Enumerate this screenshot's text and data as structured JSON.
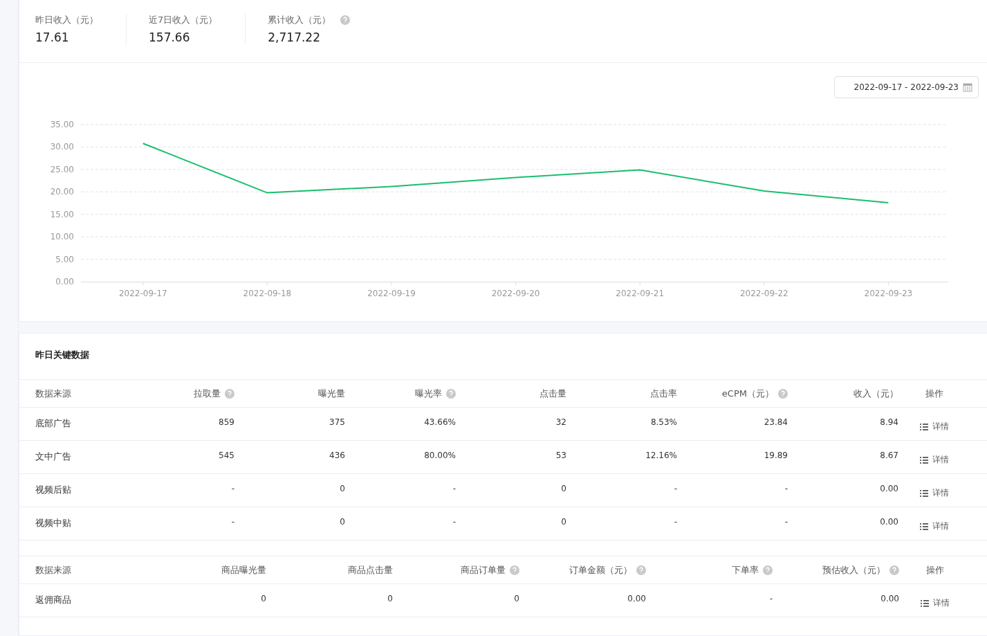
{
  "stats": [
    {
      "label": "昨日收入（元）",
      "value": "17.61",
      "help": false
    },
    {
      "label": "近7日收入（元）",
      "value": "157.66",
      "help": false
    },
    {
      "label": "累计收入（元）",
      "value": "2,717.22",
      "help": true
    }
  ],
  "date_range": "2022-09-17 - 2022-09-23",
  "chart_data": {
    "type": "line",
    "categories": [
      "2022-09-17",
      "2022-09-18",
      "2022-09-19",
      "2022-09-20",
      "2022-09-21",
      "2022-09-22",
      "2022-09-23"
    ],
    "series": [
      {
        "color": "#19be6b",
        "values": [
          30.8,
          19.8,
          21.2,
          23.2,
          24.9,
          20.2,
          17.6
        ]
      }
    ],
    "grid": true,
    "ylim": [
      0,
      35
    ],
    "yticks": [
      {
        "value": 0,
        "label": "0.00"
      },
      {
        "value": 5,
        "label": "5.00"
      },
      {
        "value": 10,
        "label": "10.00"
      },
      {
        "value": 15,
        "label": "15.00"
      },
      {
        "value": 20,
        "label": "20.00"
      },
      {
        "value": 25,
        "label": "25.00"
      },
      {
        "value": 30,
        "label": "30.00"
      },
      {
        "value": 35,
        "label": "35.00"
      }
    ]
  },
  "key_data": {
    "title": "昨日关键数据",
    "tables": [
      {
        "kind": "ads",
        "columns": [
          {
            "label": "数据来源",
            "help": false
          },
          {
            "label": "拉取量",
            "help": true
          },
          {
            "label": "曝光量",
            "help": false
          },
          {
            "label": "曝光率",
            "help": true
          },
          {
            "label": "点击量",
            "help": false
          },
          {
            "label": "点击率",
            "help": false
          },
          {
            "label": "eCPM（元）",
            "help": true
          },
          {
            "label": "收入（元）",
            "help": false
          },
          {
            "label": "操作",
            "help": false
          }
        ],
        "rows": [
          {
            "cells": [
              "底部广告",
              "859",
              "375",
              "43.66%",
              "32",
              "8.53%",
              "23.84",
              "8.94"
            ],
            "action": "详情"
          },
          {
            "cells": [
              "文中广告",
              "545",
              "436",
              "80.00%",
              "53",
              "12.16%",
              "19.89",
              "8.67"
            ],
            "action": "详情"
          },
          {
            "cells": [
              "视频后贴",
              "-",
              "0",
              "-",
              "0",
              "-",
              "-",
              "0.00"
            ],
            "action": "详情"
          },
          {
            "cells": [
              "视频中贴",
              "-",
              "0",
              "-",
              "0",
              "-",
              "-",
              "0.00"
            ],
            "action": "详情"
          }
        ]
      },
      {
        "kind": "goods",
        "columns": [
          {
            "label": "数据来源",
            "help": false
          },
          {
            "label": "商品曝光量",
            "help": false
          },
          {
            "label": "商品点击量",
            "help": false
          },
          {
            "label": "商品订单量",
            "help": true
          },
          {
            "label": "订单金额（元）",
            "help": true
          },
          {
            "label": "下单率",
            "help": true
          },
          {
            "label": "预估收入（元）",
            "help": true
          },
          {
            "label": "操作",
            "help": false
          }
        ],
        "rows": [
          {
            "cells": [
              "返佣商品",
              "0",
              "0",
              "0",
              "0.00",
              "-",
              "0.00"
            ],
            "action": "详情"
          }
        ]
      }
    ]
  }
}
